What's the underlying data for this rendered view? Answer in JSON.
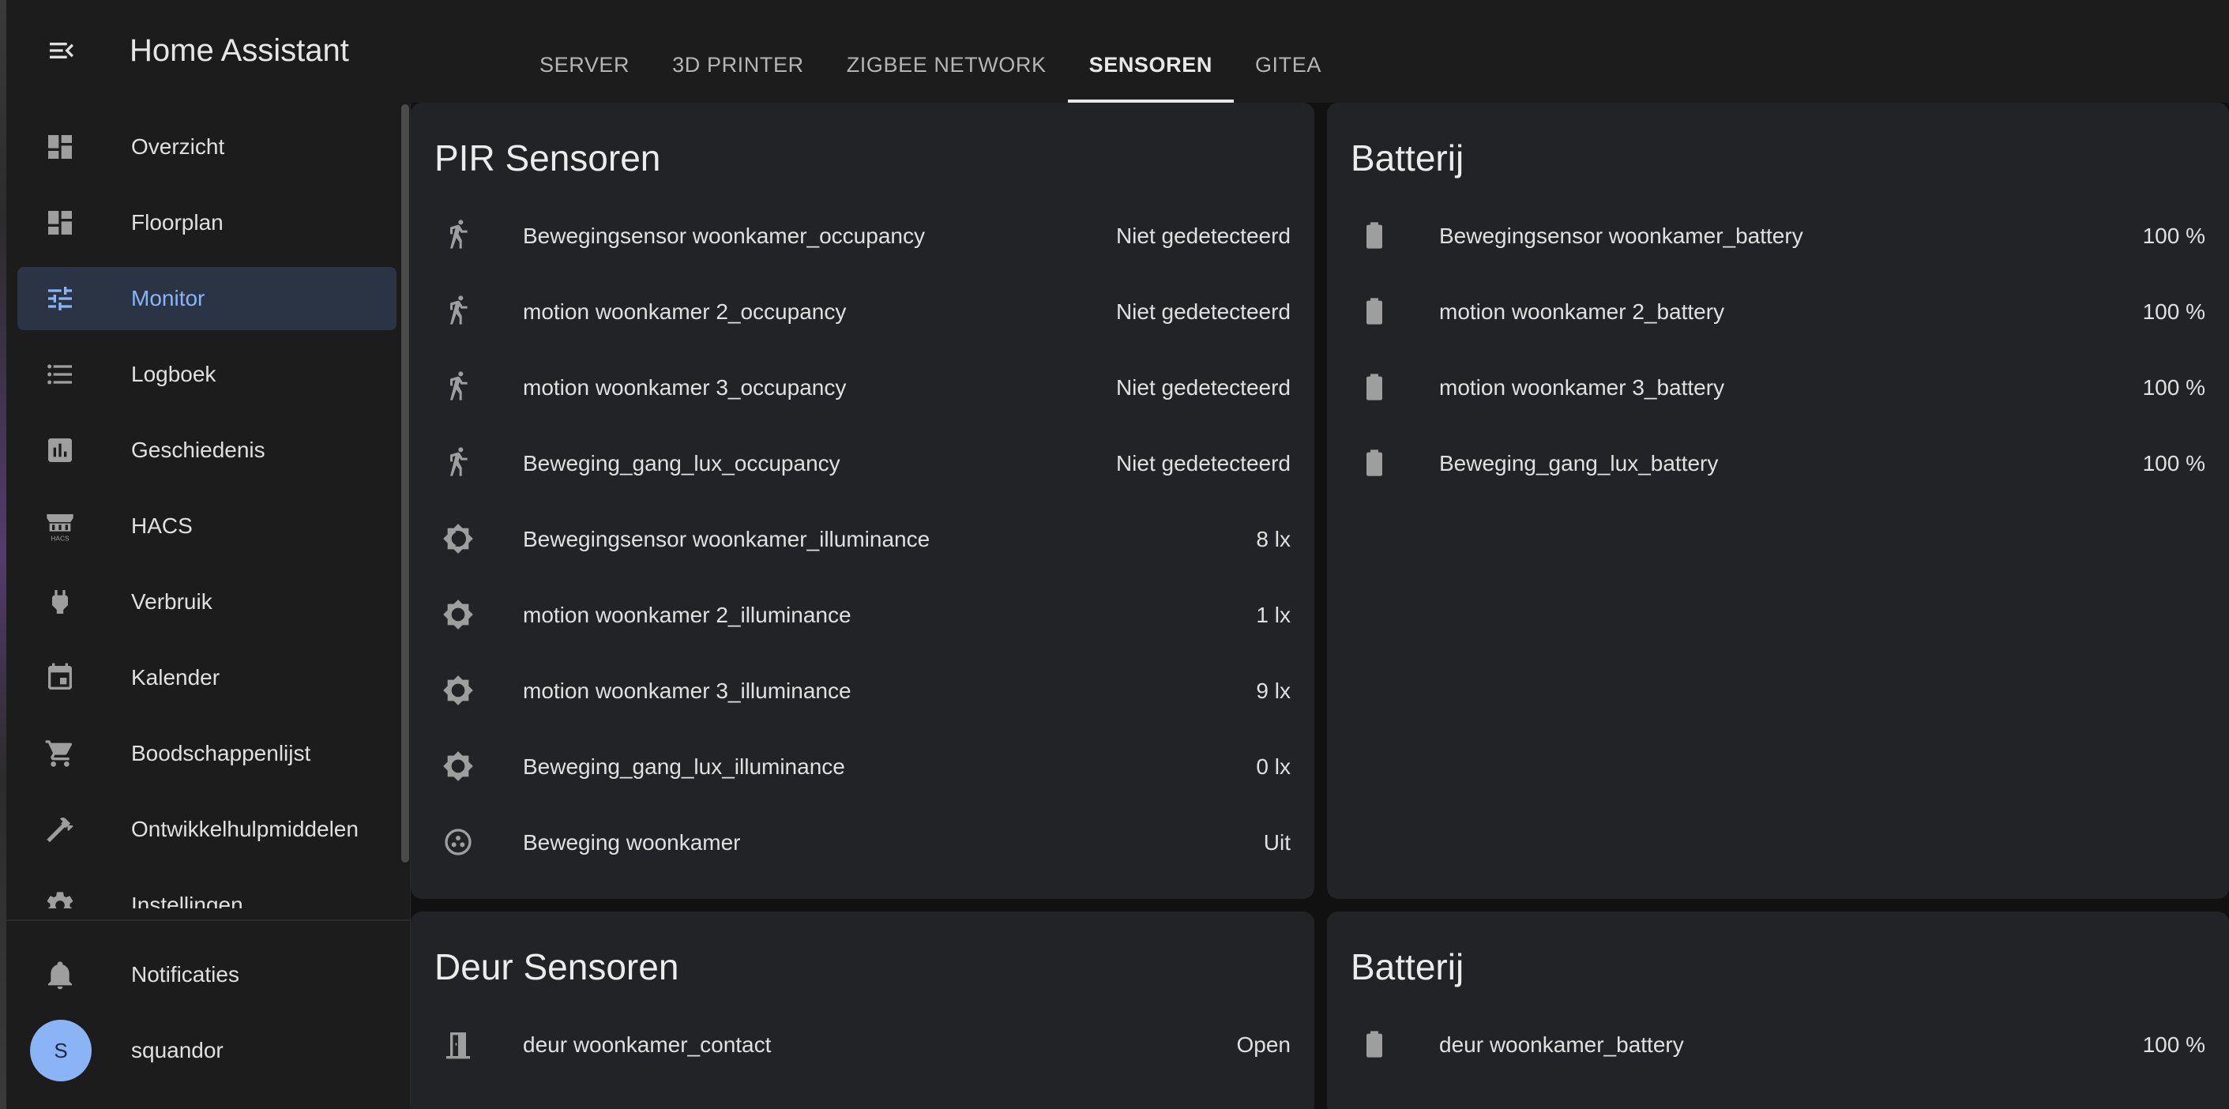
{
  "app": {
    "title": "Home Assistant"
  },
  "tabs": [
    {
      "label": "SERVER"
    },
    {
      "label": "3D PRINTER"
    },
    {
      "label": "ZIGBEE NETWORK"
    },
    {
      "label": "SENSOREN",
      "active": true
    },
    {
      "label": "GITEA"
    }
  ],
  "sidebar": {
    "items": [
      {
        "label": "Overzicht",
        "icon": "dashboard-icon"
      },
      {
        "label": "Floorplan",
        "icon": "dashboard-icon"
      },
      {
        "label": "Monitor",
        "icon": "tune-icon",
        "active": true
      },
      {
        "label": "Logboek",
        "icon": "format-list-icon"
      },
      {
        "label": "Geschiedenis",
        "icon": "chart-box-icon"
      },
      {
        "label": "HACS",
        "icon": "hacs-icon"
      },
      {
        "label": "Verbruik",
        "icon": "lightning-plug-icon"
      },
      {
        "label": "Kalender",
        "icon": "calendar-icon"
      },
      {
        "label": "Boodschappenlijst",
        "icon": "cart-icon"
      },
      {
        "label": "Ontwikkelhulpmiddelen",
        "icon": "hammer-icon"
      },
      {
        "label": "Instellingen",
        "icon": "cog-icon"
      }
    ],
    "notifications": {
      "label": "Notificaties",
      "icon": "bell-icon"
    },
    "user": {
      "name": "squandor",
      "initial": "S"
    }
  },
  "cards": {
    "pir": {
      "title": "PIR Sensoren",
      "rows": [
        {
          "name": "Bewegingsensor woonkamer_occupancy",
          "state": "Niet gedetecteerd",
          "icon": "walk-icon"
        },
        {
          "name": "motion woonkamer 2_occupancy",
          "state": "Niet gedetecteerd",
          "icon": "walk-icon"
        },
        {
          "name": "motion woonkamer 3_occupancy",
          "state": "Niet gedetecteerd",
          "icon": "walk-icon"
        },
        {
          "name": "Beweging_gang_lux_occupancy",
          "state": "Niet gedetecteerd",
          "icon": "walk-icon"
        },
        {
          "name": "Bewegingsensor woonkamer_illuminance",
          "state": "8 lx",
          "icon": "brightness-icon"
        },
        {
          "name": "motion woonkamer 2_illuminance",
          "state": "1 lx",
          "icon": "brightness-icon"
        },
        {
          "name": "motion woonkamer 3_illuminance",
          "state": "9 lx",
          "icon": "brightness-icon"
        },
        {
          "name": "Beweging_gang_lux_illuminance",
          "state": "0 lx",
          "icon": "brightness-icon"
        },
        {
          "name": "Beweging woonkamer",
          "state": "Uit",
          "icon": "motion-sensor-off-icon"
        }
      ]
    },
    "battery1": {
      "title": "Batterij",
      "rows": [
        {
          "name": "Bewegingsensor woonkamer_battery",
          "state": "100 %",
          "icon": "battery-icon"
        },
        {
          "name": "motion woonkamer 2_battery",
          "state": "100 %",
          "icon": "battery-icon"
        },
        {
          "name": "motion woonkamer 3_battery",
          "state": "100 %",
          "icon": "battery-icon"
        },
        {
          "name": "Beweging_gang_lux_battery",
          "state": "100 %",
          "icon": "battery-icon"
        }
      ]
    },
    "door": {
      "title": "Deur Sensoren",
      "rows": [
        {
          "name": "deur woonkamer_contact",
          "state": "Open",
          "icon": "door-open-icon"
        }
      ]
    },
    "battery2": {
      "title": "Batterij",
      "rows": [
        {
          "name": "deur woonkamer_battery",
          "state": "100 %",
          "icon": "battery-icon"
        }
      ]
    }
  },
  "colors": {
    "background": "#111111",
    "card": "#222326",
    "topbar": "#1c1c1c",
    "accent": "#8bb4f7",
    "active_item_bg": "#2b3444",
    "icon": "#9e9e9e"
  }
}
